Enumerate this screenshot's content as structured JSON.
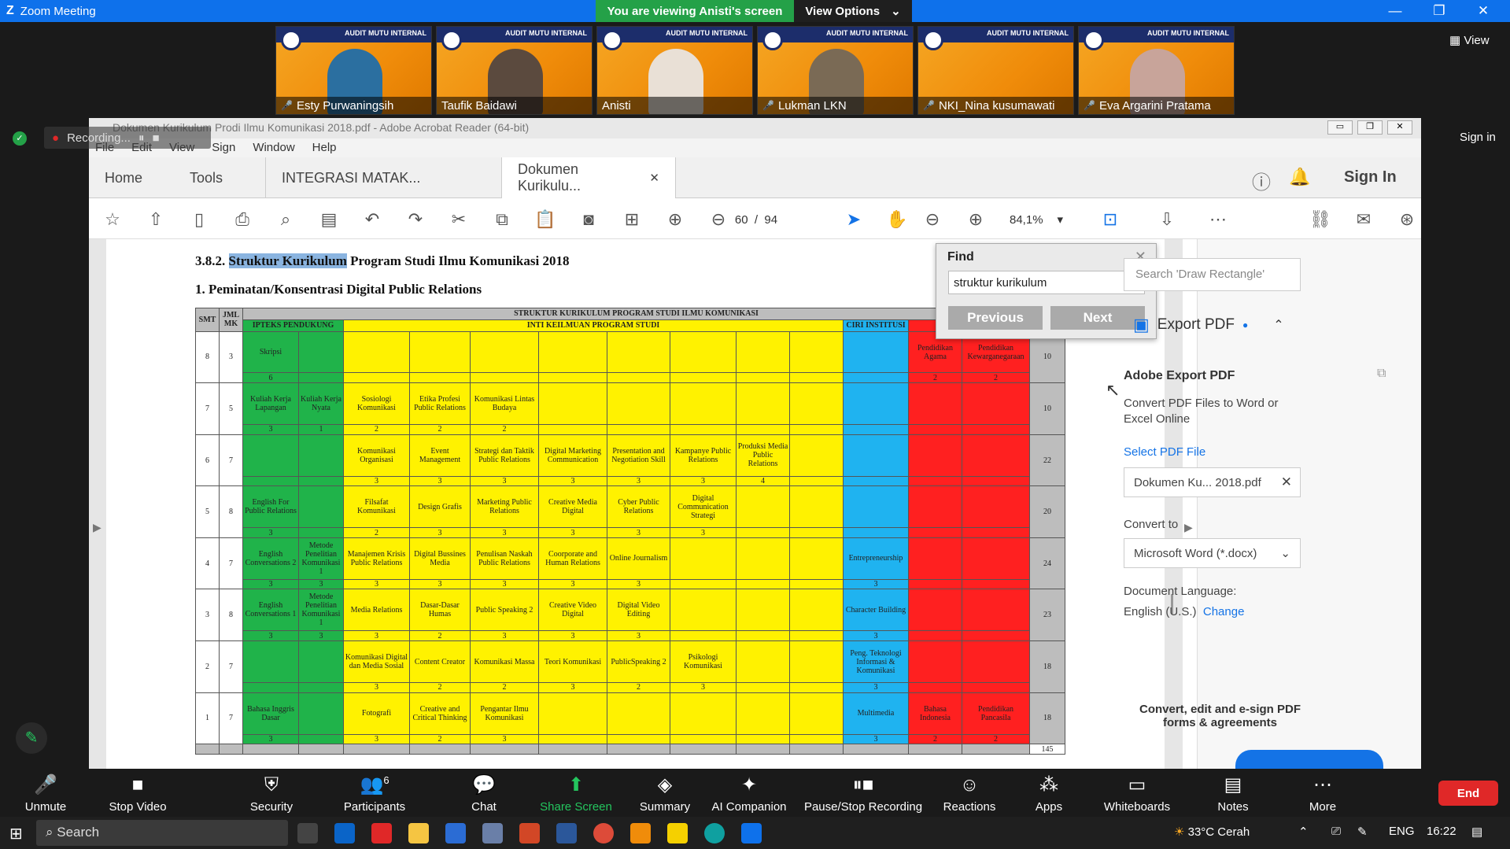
{
  "zoom": {
    "title": "Zoom Meeting",
    "viewing_banner": "You are viewing Anisti's screen",
    "view_options": "View Options",
    "view_label": "View",
    "sign_in": "Sign in",
    "recording": "Recording...",
    "participants_thumbs": [
      {
        "name": "Esty Purwaningsih",
        "banner": "AUDIT MUTU INTERNAL"
      },
      {
        "name": "Taufik Baidawi",
        "banner": "AUDIT MUTU INTERNAL"
      },
      {
        "name": "Anisti",
        "banner": "AUDIT MUTU INTERNAL"
      },
      {
        "name": "Lukman LKN",
        "banner": "AUDIT MUTU INTERNAL"
      },
      {
        "name": "NKI_Nina kusumawati",
        "banner": "AUDIT MUTU INTERNAL"
      },
      {
        "name": "Eva Argarini Pratama",
        "banner": "AUDIT MUTU INTERNAL"
      }
    ],
    "controls": {
      "unmute": "Unmute",
      "stop_video": "Stop Video",
      "security": "Security",
      "participants": "Participants",
      "participants_count": "6",
      "chat": "Chat",
      "share_screen": "Share Screen",
      "summary": "Summary",
      "ai_companion": "AI Companion",
      "pause_stop_recording": "Pause/Stop Recording",
      "reactions": "Reactions",
      "apps": "Apps",
      "whiteboards": "Whiteboards",
      "notes": "Notes",
      "more": "More",
      "end": "End"
    }
  },
  "acrobat": {
    "title": "Dokumen Kurikulum Prodi Ilmu Komunikasi 2018.pdf - Adobe Acrobat Reader (64-bit)",
    "menu": [
      "File",
      "Edit",
      "View",
      "Sign",
      "Window",
      "Help"
    ],
    "tabs": {
      "home": "Home",
      "tools": "Tools",
      "doc1": "INTEGRASI MATAK...",
      "doc2": "Dokumen Kurikulu..."
    },
    "sign_in": "Sign In",
    "page_current": "60",
    "page_total": "94",
    "zoom": "84,1%",
    "find": {
      "title": "Find",
      "query": "struktur kurikulum",
      "previous": "Previous",
      "next": "Next"
    },
    "right_pane": {
      "search_placeholder": "Search 'Draw Rectangle'",
      "export_pdf": "Export PDF",
      "adobe_export_pdf": "Adobe Export PDF",
      "convert_desc": "Convert PDF Files to Word or Excel Online",
      "select_pdf_file": "Select PDF File",
      "file_name": "Dokumen Ku... 2018.pdf",
      "convert_to": "Convert to",
      "convert_option": "Microsoft Word (*.docx)",
      "doc_language": "Document Language:",
      "language": "English (U.S.)",
      "change": "Change",
      "cta": "Convert, edit and e-sign PDF forms & agreements"
    }
  },
  "document": {
    "section_prefix": "3.8.2.",
    "section_highlight": "Struktur Kurikulum",
    "section_rest": "Program Studi Ilmu Komunikasi 2018",
    "subtitle": "1. Peminatan/Konsentrasi Digital Public Relations",
    "table": {
      "h_smt": "SMT",
      "h_jml": "JML MK",
      "h_main": "STRUKTUR KURIKULUM PROGRAM STUDI ILMU KOMUNIKASI",
      "h_iptek": "IPTEKS PENDUKUNG",
      "h_inti": "INTI KEILMUAN PROGRAM STUDI",
      "h_ciri": "CIRI INSTITUSI",
      "total": "145",
      "rows": [
        {
          "smt": "8",
          "jml": "3",
          "sks": "10",
          "c": [
            "Skripsi",
            "",
            "",
            "",
            "",
            "",
            "",
            "",
            "",
            "",
            "",
            "Pendidikan Agama",
            "Pendidikan Kewarganegaraan"
          ],
          "n": [
            "6",
            "",
            "",
            "",
            "",
            "",
            "",
            "",
            "",
            "",
            "",
            "2",
            "2"
          ]
        },
        {
          "smt": "7",
          "jml": "5",
          "sks": "10",
          "c": [
            "Kuliah Kerja Lapangan",
            "Kuliah Kerja Nyata",
            "Sosiologi Komunikasi",
            "Etika Profesi Public Relations",
            "Komunikasi Lintas Budaya",
            "",
            "",
            "",
            "",
            "",
            "",
            "",
            ""
          ],
          "n": [
            "3",
            "1",
            "2",
            "2",
            "2",
            "",
            "",
            "",
            "",
            "",
            "",
            "",
            ""
          ]
        },
        {
          "smt": "6",
          "jml": "7",
          "sks": "22",
          "c": [
            "",
            "",
            "Komunikasi Organisasi",
            "Event Management",
            "Strategi dan Taktik Public Relations",
            "Digital Marketing Communication",
            "Presentation and Negotiation Skill",
            "Kampanye Public Relations",
            "Produksi Media Public Relations",
            "",
            "",
            "",
            ""
          ],
          "n": [
            "",
            "",
            "3",
            "3",
            "3",
            "3",
            "3",
            "3",
            "4",
            "",
            "",
            "",
            ""
          ]
        },
        {
          "smt": "5",
          "jml": "8",
          "sks": "20",
          "c": [
            "English For Public Relations",
            "",
            "Filsafat Komunikasi",
            "Design Grafis",
            "Marketing Public Relations",
            "Creative Media Digital",
            "Cyber Public Relations",
            "Digital Communication Strategi",
            "",
            "",
            "",
            "",
            ""
          ],
          "n": [
            "3",
            "",
            "2",
            "3",
            "3",
            "3",
            "3",
            "3",
            "",
            "",
            "",
            "",
            ""
          ]
        },
        {
          "smt": "4",
          "jml": "7",
          "sks": "24",
          "c": [
            "English Conversations 2",
            "Metode Penelitian Komunikasi 1",
            "Manajemen Krisis Public Relations",
            "Digital Bussines Media",
            "Penulisan Naskah Public Relations",
            "Coorporate and Human Relations",
            "Online Journalism",
            "",
            "",
            "",
            "Entrepreneurship",
            "",
            ""
          ],
          "n": [
            "3",
            "3",
            "3",
            "3",
            "3",
            "3",
            "3",
            "",
            "",
            "",
            "3",
            "",
            ""
          ]
        },
        {
          "smt": "3",
          "jml": "8",
          "sks": "23",
          "c": [
            "English Conversations 1",
            "Metode Penelitian Komunikasi 1",
            "Media Relations",
            "Dasar-Dasar Humas",
            "Public Speaking 2",
            "Creative Video Digital",
            "Digital Video Editing",
            "",
            "",
            "",
            "Character Building",
            "",
            ""
          ],
          "n": [
            "3",
            "3",
            "3",
            "2",
            "3",
            "3",
            "3",
            "",
            "",
            "",
            "3",
            "",
            ""
          ]
        },
        {
          "smt": "2",
          "jml": "7",
          "sks": "18",
          "c": [
            "",
            "",
            "Komunikasi Digital dan Media Sosial",
            "Content Creator",
            "Komunikasi Massa",
            "Teori Komunikasi",
            "PublicSpeaking 2",
            "Psikologi Komunikasi",
            "",
            "",
            "Peng. Teknologi Informasi & Komunikasi",
            "",
            ""
          ],
          "n": [
            "",
            "",
            "3",
            "2",
            "2",
            "3",
            "2",
            "3",
            "",
            "",
            "3",
            "",
            ""
          ]
        },
        {
          "smt": "1",
          "jml": "7",
          "sks": "18",
          "c": [
            "Bahasa Inggris Dasar",
            "",
            "Fotografi",
            "Creative and Critical Thinking",
            "Pengantar Ilmu Komunikasi",
            "",
            "",
            "",
            "",
            "",
            "Multimedia",
            "Bahasa Indonesia",
            "Pendidikan Pancasila"
          ],
          "n": [
            "3",
            "",
            "3",
            "2",
            "3",
            "",
            "",
            "",
            "",
            "",
            "3",
            "2",
            "2"
          ]
        }
      ]
    }
  },
  "taskbar": {
    "search": "Search",
    "weather": "33°C Cerah",
    "lang": "ENG",
    "time": "16:22"
  }
}
